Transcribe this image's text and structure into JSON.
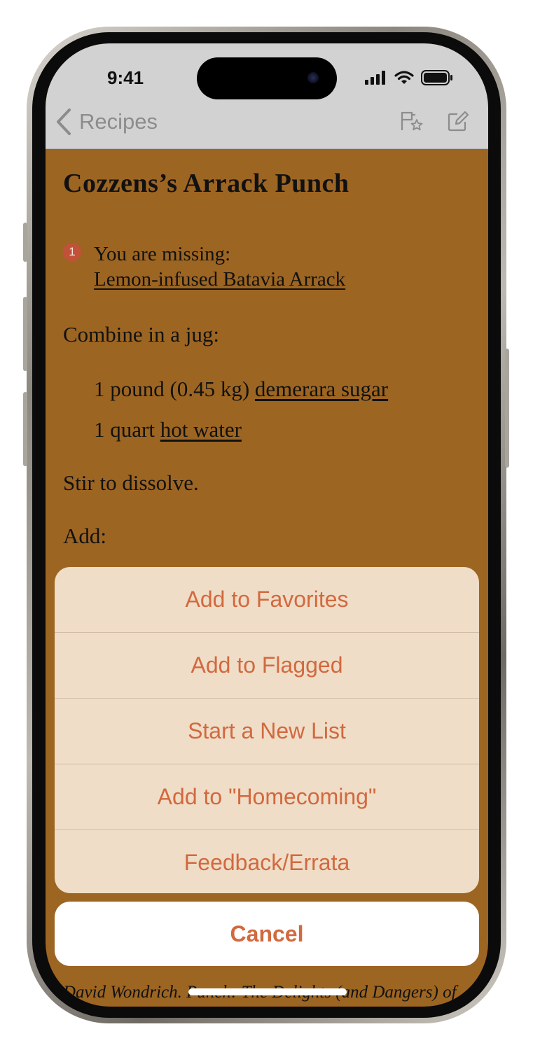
{
  "status_bar": {
    "time": "9:41"
  },
  "nav": {
    "back_label": "Recipes",
    "back_icon": "chevron-left-icon",
    "flag_star_icon": "flag-star-icon",
    "edit_icon": "compose-icon"
  },
  "recipe": {
    "title": "Cozzens’s Arrack Punch",
    "missing_count": "1",
    "missing_label": "You are missing:",
    "missing_item": "Lemon-infused Batavia Arrack",
    "step1": "Combine in a jug:",
    "ingredients": [
      {
        "qty": "1 pound (0.45 kg)",
        "name": "demerara sugar"
      },
      {
        "qty": "1 quart",
        "name": "hot water"
      }
    ],
    "step2": "Stir to dissolve.",
    "step3": "Add:",
    "citation": "David Wondrich. Punch: The Delights (and Dangers) of"
  },
  "action_sheet": {
    "actions": [
      "Add to Favorites",
      "Add to Flagged",
      "Start a New List",
      "Add to \"Homecoming\"",
      "Feedback/Errata"
    ],
    "cancel": "Cancel"
  },
  "colors": {
    "background": "#9d6522",
    "accent": "#d2693f",
    "badge": "#c2513a",
    "sheet": "#f5e6d4"
  }
}
